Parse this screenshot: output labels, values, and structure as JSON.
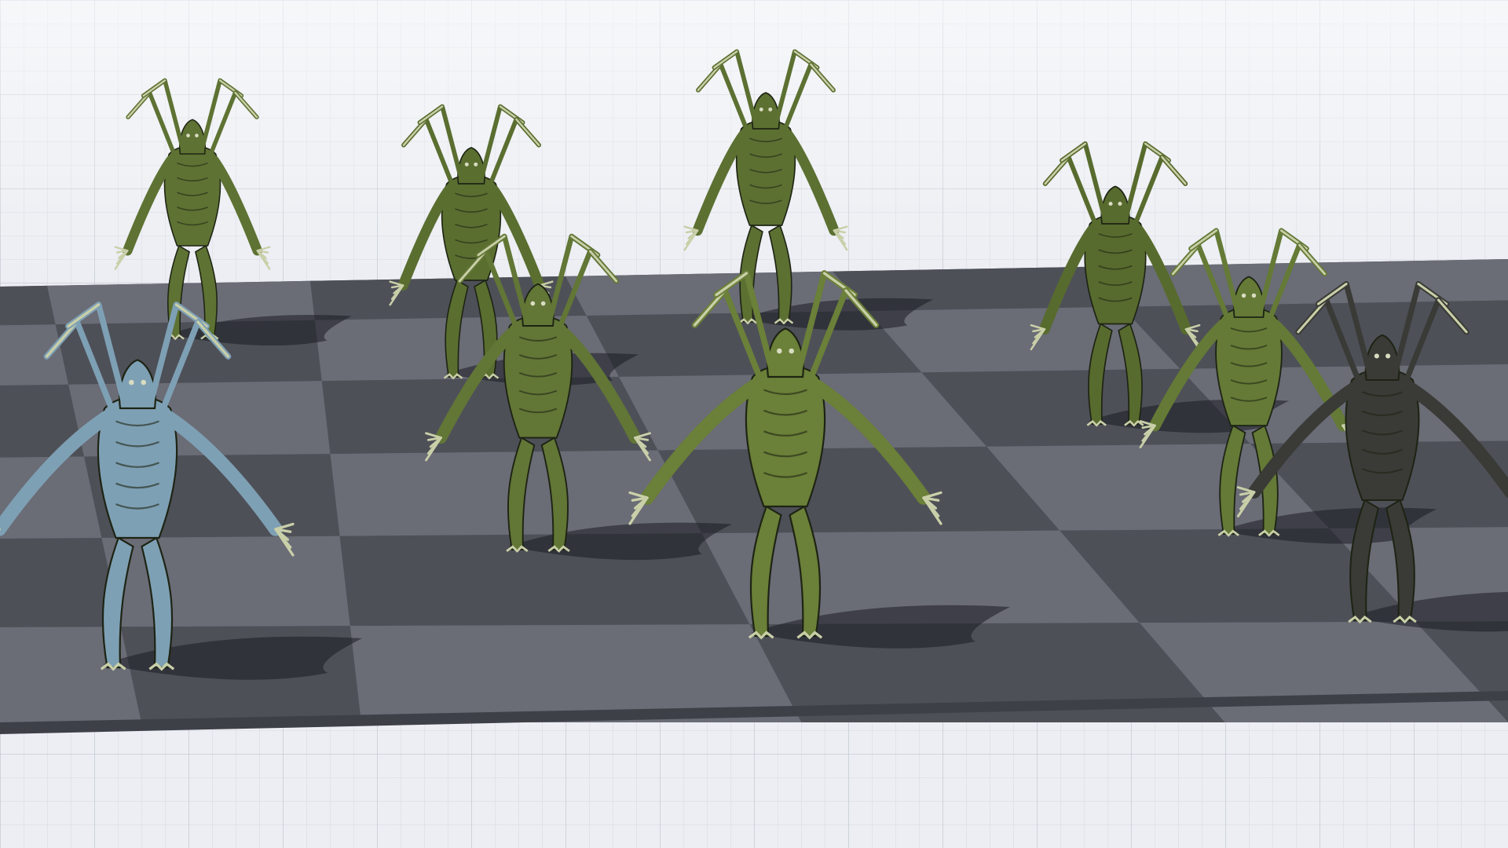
{
  "scene": {
    "kind": "3d-editor-viewport",
    "background_grid_color": "#e9ecf1",
    "floor_dark_color": "#4e5058",
    "floor_light_color": "#6a6c76",
    "creature_count": 9
  },
  "creatures": [
    {
      "variant": "green",
      "color": "#5e7233",
      "pose": "crouch"
    },
    {
      "variant": "ice-blue",
      "color": "#7ea0b4",
      "pose": "spread"
    },
    {
      "variant": "green",
      "color": "#5a6e30",
      "pose": "crouch"
    },
    {
      "variant": "green",
      "color": "#627636",
      "pose": "walk"
    },
    {
      "variant": "green",
      "color": "#5c7032",
      "pose": "crouch"
    },
    {
      "variant": "green",
      "color": "#6b8038",
      "pose": "spread"
    },
    {
      "variant": "green",
      "color": "#586b2e",
      "pose": "crouch"
    },
    {
      "variant": "green",
      "color": "#647a36",
      "pose": "walk"
    },
    {
      "variant": "charcoal",
      "color": "#3a3a36",
      "pose": "spread"
    }
  ]
}
